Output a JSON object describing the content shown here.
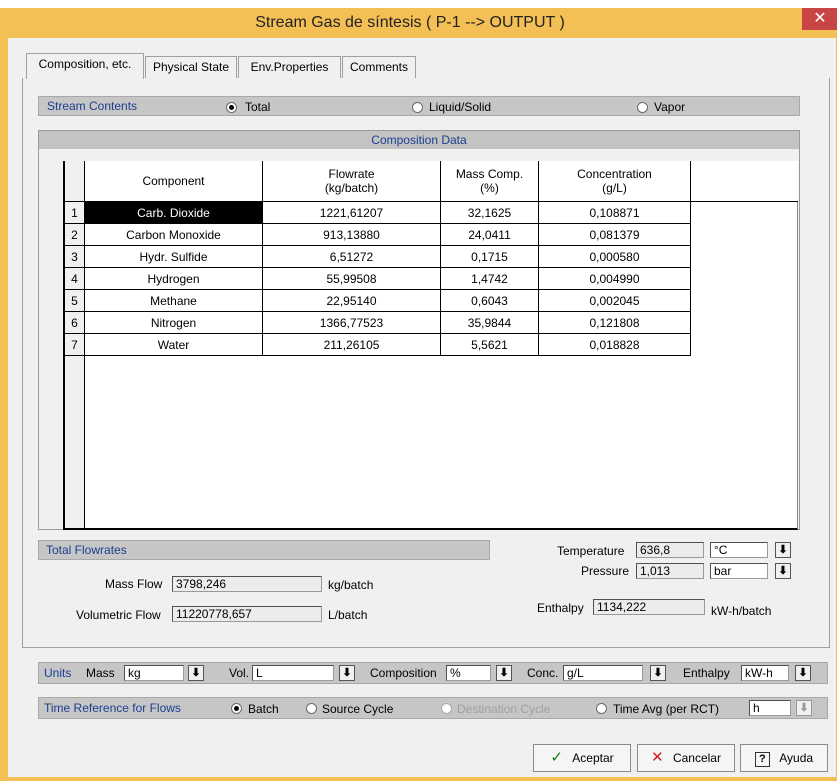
{
  "window": {
    "title": "Stream Gas de síntesis ( P-1 --> OUTPUT )",
    "close_icon": "close-icon"
  },
  "tabs": [
    {
      "label": "Composition, etc.",
      "active": true
    },
    {
      "label": "Physical State",
      "active": false
    },
    {
      "label": "Env.Properties",
      "active": false
    },
    {
      "label": "Comments",
      "active": false
    }
  ],
  "stream_contents": {
    "label": "Stream Contents",
    "options": [
      "Total",
      "Liquid/Solid",
      "Vapor"
    ],
    "selected": "Total"
  },
  "composition": {
    "title": "Composition Data",
    "headers": [
      "Component",
      "Flowrate\n(kg/batch)",
      "Mass Comp.\n(%)",
      "Concentration\n(g/L)"
    ],
    "rows": [
      {
        "n": "1",
        "component": "Carb. Dioxide",
        "flowrate": "1221,61207",
        "mass_comp": "32,1625",
        "conc": "0,108871"
      },
      {
        "n": "2",
        "component": "Carbon Monoxide",
        "flowrate": "913,13880",
        "mass_comp": "24,0411",
        "conc": "0,081379"
      },
      {
        "n": "3",
        "component": "Hydr. Sulfide",
        "flowrate": "6,51272",
        "mass_comp": "0,1715",
        "conc": "0,000580"
      },
      {
        "n": "4",
        "component": "Hydrogen",
        "flowrate": "55,99508",
        "mass_comp": "1,4742",
        "conc": "0,004990"
      },
      {
        "n": "5",
        "component": "Methane",
        "flowrate": "22,95140",
        "mass_comp": "0,6043",
        "conc": "0,002045"
      },
      {
        "n": "6",
        "component": "Nitrogen",
        "flowrate": "1366,77523",
        "mass_comp": "35,9844",
        "conc": "0,121808"
      },
      {
        "n": "7",
        "component": "Water",
        "flowrate": "211,26105",
        "mass_comp": "5,5621",
        "conc": "0,018828"
      }
    ]
  },
  "total_flowrates": {
    "label": "Total Flowrates",
    "mass_flow_label": "Mass Flow",
    "mass_flow_value": "3798,246",
    "mass_flow_unit": "kg/batch",
    "vol_flow_label": "Volumetric Flow",
    "vol_flow_value": "11220778,657",
    "vol_flow_unit": "L/batch"
  },
  "state": {
    "temperature_label": "Temperature",
    "temperature_value": "636,8",
    "temperature_unit": "°C",
    "pressure_label": "Pressure",
    "pressure_value": "1,013",
    "pressure_unit": "bar",
    "enthalpy_label": "Enthalpy",
    "enthalpy_value": "1134,222",
    "enthalpy_unit": "kW-h/batch"
  },
  "units": {
    "label": "Units",
    "mass_label": "Mass",
    "mass_value": "kg",
    "vol_label": "Vol.",
    "vol_value": "L",
    "composition_label": "Composition",
    "composition_value": "%",
    "conc_label": "Conc.",
    "conc_value": "g/L",
    "enthalpy_label": "Enthalpy",
    "enthalpy_value": "kW-h"
  },
  "time_ref": {
    "label": "Time Reference for Flows",
    "options": [
      "Batch",
      "Source Cycle",
      "Destination Cycle",
      "Time Avg (per RCT)"
    ],
    "selected": "Batch",
    "time_unit": "h"
  },
  "buttons": {
    "accept": "Aceptar",
    "cancel": "Cancelar",
    "help": "Ayuda"
  },
  "colors": {
    "title_bar": "#f4bf55",
    "accent_text": "#1b3f8f",
    "selected_cell": "#000000"
  }
}
